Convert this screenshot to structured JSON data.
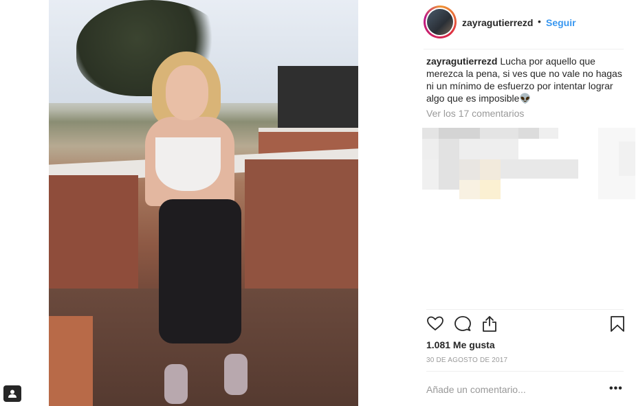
{
  "post": {
    "username": "zayragutierrezd",
    "separator": "•",
    "follow_label": "Seguir",
    "caption_username": "zayragutierrezd",
    "caption_text": "Lucha por aquello que merezca la pena, si ves que no vale no hagas ni un mínimo de esfuerzo por intentar lograr algo que es imposible👽",
    "view_comments_label": "Ver los 17 comentarios",
    "likes_label": "1.081 Me gusta",
    "date_label": "30 DE AGOSTO DE 2017",
    "comment_placeholder": "Añade un comentario...",
    "more_label": "•••"
  },
  "icons": {
    "like": "heart-icon",
    "comment": "comment-icon",
    "share": "share-icon",
    "save": "bookmark-icon",
    "badge": "user-tag-icon"
  },
  "colors": {
    "accent": "#3897f0",
    "muted": "#999999",
    "text": "#262626",
    "divider": "#efefef"
  }
}
